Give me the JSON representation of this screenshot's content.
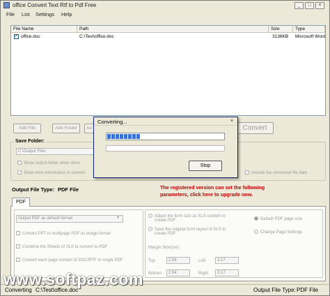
{
  "window": {
    "title": "office Convert Text Rtf to Pdf Free",
    "minimize": "_",
    "maximize": "□",
    "close": "×"
  },
  "menu": [
    "File",
    "List",
    "Settings",
    "Help"
  ],
  "file_list": {
    "columns": [
      "File Name",
      "Path",
      "Size",
      "Type"
    ],
    "rows": [
      {
        "checked": true,
        "name": "office.doc",
        "path": "C:\\Test\\office.doc",
        "size": "3136KB",
        "type": "Microsoft Word"
      }
    ]
  },
  "toolbar": {
    "add_file": "Add File",
    "add_folder": "Add Folder",
    "add_partial": "Ad",
    "convert": "Convert"
  },
  "save_folder": {
    "title": "Save Folder:",
    "path": "C:\\Output Files",
    "show_output": "Show output folder when done",
    "show_error": "Show error information in convert",
    "include_date": "Include the converted file date"
  },
  "output_type": {
    "label": "Output File Type:",
    "value": "PDF File"
  },
  "upgrade_notice": {
    "line1": "The registered version can set the following",
    "line2": "parameters, click here to upgrade now."
  },
  "tabs": {
    "pdf": "PDF"
  },
  "pdf_options": {
    "select": "Output PDF as default format",
    "ppt": "Convert PPT to multipage PDF as image format",
    "xls_combine": "Combine the Sheets of XLS to convert to PDF",
    "each_page": "Convert each page content of DOC/RTF to single PDF"
  },
  "page_options": {
    "adjust_1": "Adjust the form size as XLS content to",
    "adjust_2": "create PDF",
    "save_1": "Save the original form layout of XLS to",
    "save_2": "create PDF",
    "default_size": "Default PDF page size",
    "change_settings": "Change Page Settings",
    "margin_label": "Margin Size(cm):",
    "top_label": "Top",
    "top_value": "2.54",
    "left_label": "Left",
    "left_value": "3.17",
    "bottom_label": "Bottom",
    "bottom_value": "2.54",
    "right_label": "Right",
    "right_value": "3.17"
  },
  "dialog": {
    "title": "Converting...",
    "close": "×",
    "stop": "Stop",
    "progress": 0.3
  },
  "status": {
    "converting": "Converting",
    "path": "C:\\Test\\office.doc",
    "output": "Output File Type:",
    "output_value": "PDF File"
  },
  "watermark": "www.softpaz.com"
}
